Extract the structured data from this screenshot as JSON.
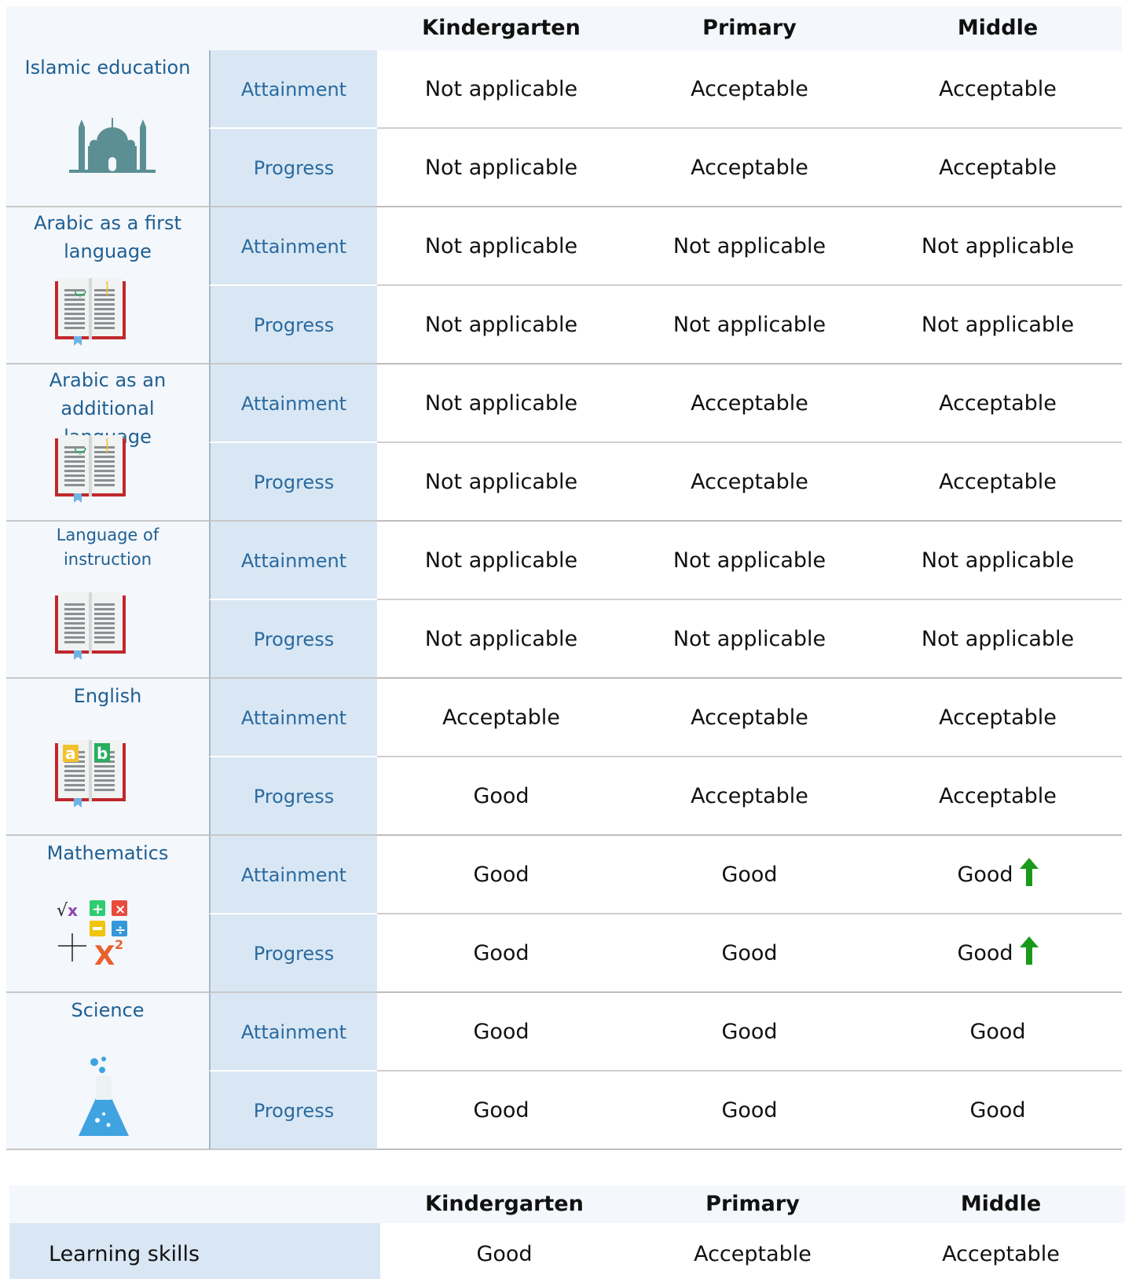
{
  "columns": [
    "Kindergarten",
    "Primary",
    "Middle"
  ],
  "subjects": [
    {
      "name": "Islamic education",
      "icon": "mosque-icon",
      "rows": [
        {
          "metric": "Attainment",
          "values": [
            "Not applicable",
            "Acceptable",
            "Acceptable"
          ]
        },
        {
          "metric": "Progress",
          "values": [
            "Not applicable",
            "Acceptable",
            "Acceptable"
          ]
        }
      ]
    },
    {
      "name": "Arabic as a first language",
      "icon": "arabic-book-icon",
      "rows": [
        {
          "metric": "Attainment",
          "values": [
            "Not applicable",
            "Not applicable",
            "Not applicable"
          ]
        },
        {
          "metric": "Progress",
          "values": [
            "Not applicable",
            "Not applicable",
            "Not applicable"
          ]
        }
      ]
    },
    {
      "name": "Arabic as an additional language",
      "icon": "arabic-book-icon",
      "rows": [
        {
          "metric": "Attainment",
          "values": [
            "Not applicable",
            "Acceptable",
            "Acceptable"
          ]
        },
        {
          "metric": "Progress",
          "values": [
            "Not applicable",
            "Acceptable",
            "Acceptable"
          ]
        }
      ]
    },
    {
      "name": "Language of instruction",
      "icon": "book-icon",
      "rows": [
        {
          "metric": "Attainment",
          "values": [
            "Not applicable",
            "Not applicable",
            "Not applicable"
          ]
        },
        {
          "metric": "Progress",
          "values": [
            "Not applicable",
            "Not applicable",
            "Not applicable"
          ]
        }
      ]
    },
    {
      "name": "English",
      "icon": "english-book-icon",
      "rows": [
        {
          "metric": "Attainment",
          "values": [
            "Acceptable",
            "Acceptable",
            "Acceptable"
          ]
        },
        {
          "metric": "Progress",
          "values": [
            "Good",
            "Acceptable",
            "Acceptable"
          ]
        }
      ]
    },
    {
      "name": "Mathematics",
      "icon": "math-symbols-icon",
      "rows": [
        {
          "metric": "Attainment",
          "values": [
            "Good",
            "Good",
            "Good"
          ],
          "improved": [
            false,
            false,
            true
          ]
        },
        {
          "metric": "Progress",
          "values": [
            "Good",
            "Good",
            "Good"
          ],
          "improved": [
            false,
            false,
            true
          ]
        }
      ]
    },
    {
      "name": "Science",
      "icon": "flask-icon",
      "rows": [
        {
          "metric": "Attainment",
          "values": [
            "Good",
            "Good",
            "Good"
          ]
        },
        {
          "metric": "Progress",
          "values": [
            "Good",
            "Good",
            "Good"
          ]
        }
      ]
    }
  ],
  "table2": {
    "columns": [
      "Kindergarten",
      "Primary",
      "Middle"
    ],
    "label": "Learning skills",
    "values": [
      "Good",
      "Acceptable",
      "Acceptable"
    ]
  },
  "colors": {
    "header_bg": "#f4f7fb",
    "metric_bg": "#d9e7f4",
    "subject_text": "#1f5f93",
    "improved_arrow": "#1a9a1a"
  }
}
